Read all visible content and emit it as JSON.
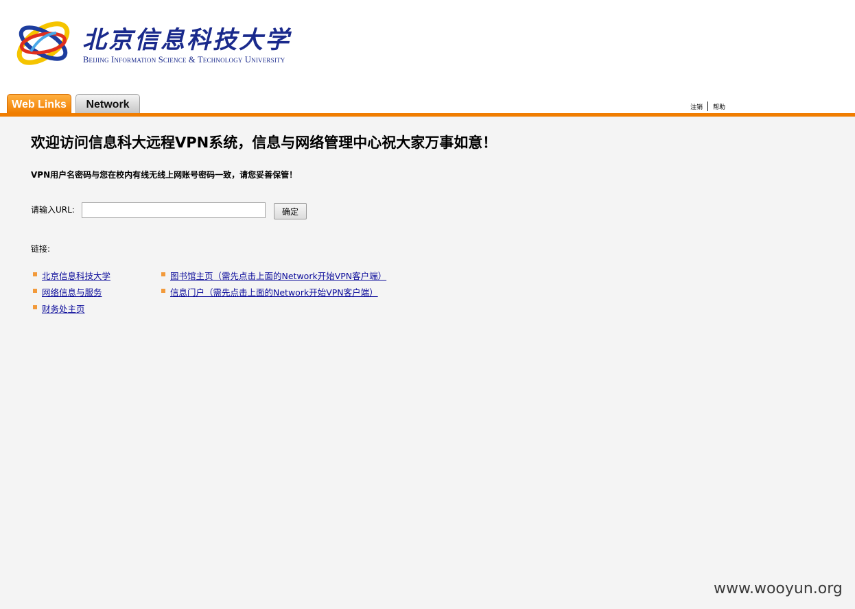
{
  "header": {
    "logo_cn": "北京信息科技大学",
    "logo_en": "Beijing Information Science & Technology University",
    "tabs": [
      {
        "label": "Web Links",
        "active": true
      },
      {
        "label": "Network",
        "active": false
      }
    ],
    "top_links": {
      "logout": "注销",
      "help": "帮助"
    }
  },
  "main": {
    "welcome": "欢迎访问信息科大远程VPN系统，信息与网络管理中心祝大家万事如意！",
    "notice": "VPN用户名密码与您在校内有线无线上网账号密码一致，请您妥善保管！",
    "url_label": "请输入URL:",
    "url_value": "",
    "ok_button": "确定",
    "links_label": "链接:",
    "links_col1": [
      "北京信息科技大学",
      "网络信息与服务",
      "财务处主页"
    ],
    "links_col2": [
      "图书馆主页（需先点击上面的Network开始VPN客户端）",
      "信息门户（需先点击上面的Network开始VPN客户端）"
    ]
  },
  "watermark": "www.wooyun.org",
  "colors": {
    "accent": "#f07d00",
    "link": "#0a0a9a",
    "logo": "#1a2a8c"
  }
}
